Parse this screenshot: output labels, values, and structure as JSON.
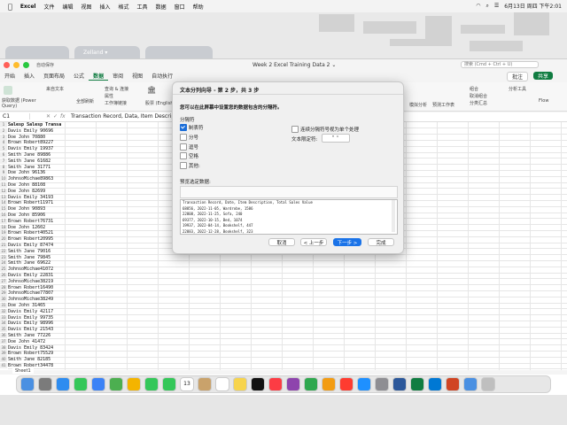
{
  "menubar": {
    "app": "Excel",
    "items": [
      "文件",
      "编辑",
      "视图",
      "插入",
      "格式",
      "工具",
      "数据",
      "窗口",
      "帮助"
    ],
    "date_time": "6月13日 周四 下午2:01"
  },
  "desktop": {
    "tabs": [
      "",
      "Zelland ▾",
      ""
    ]
  },
  "window": {
    "title": "Week 2 Excel Training Data 2 ⌄",
    "search_placeholder": "搜索 (Cmd + Ctrl + U)",
    "autosave": "自动保存",
    "ribbon_tabs": [
      "开始",
      "插入",
      "页面布局",
      "公式",
      "数据",
      "审阅",
      "视图",
      "自动执行"
    ],
    "active_tab": "数据",
    "ribbon_labels": {
      "get_data": "获取数据 (Power Query)",
      "from_text": "来自文本",
      "refresh_all": "全部刷新",
      "queries": "查询 & 连接",
      "properties": "属性",
      "edit_links": "工作簿链接",
      "stocks": "股票 (English)",
      "comment": "批注",
      "share": "共享",
      "analysis": "分析工具",
      "flow": "Flow",
      "what_if": "模拟分析",
      "forecast": "预测工作表",
      "group": "组合",
      "ungroup": "取消组合",
      "subtotal": "分类汇总"
    },
    "name_box": "C1",
    "formula": "Transaction Record, Data, Item Description, To"
  },
  "grid": {
    "row_numbers": [
      "1",
      "2",
      "3",
      "4",
      "5",
      "6",
      "7",
      "8",
      "9",
      "10",
      "11",
      "12",
      "13",
      "14",
      "15",
      "16",
      "17",
      "18",
      "19",
      "20",
      "21",
      "22",
      "23",
      "24",
      "25",
      "26",
      "27",
      "28",
      "29",
      "30",
      "31",
      "32",
      "33",
      "34",
      "35",
      "36",
      "37",
      "38",
      "39",
      "40",
      "41"
    ],
    "rows": [
      "Salesp Salesp Transa",
      "Davis Emily 90696",
      "Doe   John  70880",
      "Brown Robert89227",
      "Davis Emily 19937",
      "Smith Jane  89886",
      "Smith Jane  61682",
      "Smith Jane  31771",
      "Doe   John  96136",
      "JohnsoMichae89863",
      "Doe   John  88108",
      "Doe   John  82699",
      "Davis Emily 34193",
      "Brown Robert11971",
      "Doe   John  90893",
      "Doe   John  85906",
      "Brown Robert76731",
      "Doe   John  12602",
      "Brown Robert40521",
      "Brown Robert20995",
      "Davis Emily 87474",
      "Smith Jane  79016",
      "Smith Jane  79845",
      "Smith Jane  69622",
      "JohnsoMichae41072",
      "Davis Emily 22831",
      "JohnsoMichae38219",
      "Brown Robert16490",
      "JohnsoMichae77807",
      "JohnsoMichae38249",
      "Doe   John  31465",
      "Davis Emily 42117",
      "Davis Emily 99735",
      "Davis Emily 98996",
      "Davis Emily 21543",
      "Smith Jane  77226",
      "Doe   John  41472",
      "Davis Emily 83424",
      "Brown Robert75529",
      "Smith Jane  82185",
      "Brown Robert34478"
    ],
    "sheet_tab": "Sheet1"
  },
  "dialog": {
    "title": "文本分列向导 - 第 2 步，共 3 步",
    "instruction": "您可以在此屏幕中设置您的数据包含的分隔符。",
    "delimiters_label": "分隔符",
    "delimiters": [
      {
        "label": "制表符",
        "checked": true
      },
      {
        "label": "分号",
        "checked": false
      },
      {
        "label": "逗号",
        "checked": false
      },
      {
        "label": "空格",
        "checked": false
      },
      {
        "label": "其他:",
        "checked": false
      }
    ],
    "consecutive_label": "连续分隔符号视为单个处理",
    "consecutive_checked": false,
    "text_qualifier_label": "文本限定符:",
    "text_qualifier_value": "\"",
    "preview_label": "预览选定数据:",
    "preview_lines": [
      "Transaction Record, Date, Item Description, Total Sales Value",
      "68856, 2022-11-05, Wardrobe, 1586",
      "22808, 2022-11-25, Sofa, 240",
      "69377, 2022-10-15, Bed, 1074",
      "19937, 2022-04-14, Bookshelf, 447",
      "22883, 2022-12-28, Bookshelf, 323"
    ],
    "buttons": {
      "cancel": "取消",
      "back": "< 上一步",
      "next": "下一步 >",
      "finish": "完成"
    }
  },
  "dock": {
    "apps": [
      "finder-icon",
      "launchpad-icon",
      "safari-icon",
      "messages-icon",
      "mail-icon",
      "maps-icon",
      "photos-icon",
      "facetime-icon",
      "phone-icon",
      "calendar-icon",
      "contacts-icon",
      "reminders-icon",
      "notes-icon",
      "tv-icon",
      "music-icon",
      "podcasts-icon",
      "numbers-icon",
      "pages-icon",
      "news-icon",
      "appstore-icon",
      "settings-icon",
      "word-icon",
      "excel-icon",
      "outlook-icon",
      "powerpoint-icon",
      "downloads-icon",
      "trash-icon"
    ],
    "calendar_day": "13"
  },
  "colors": {
    "excel_green": "#107c41",
    "primary_button": "#1a73e8",
    "check_blue": "#1b6dd8"
  }
}
